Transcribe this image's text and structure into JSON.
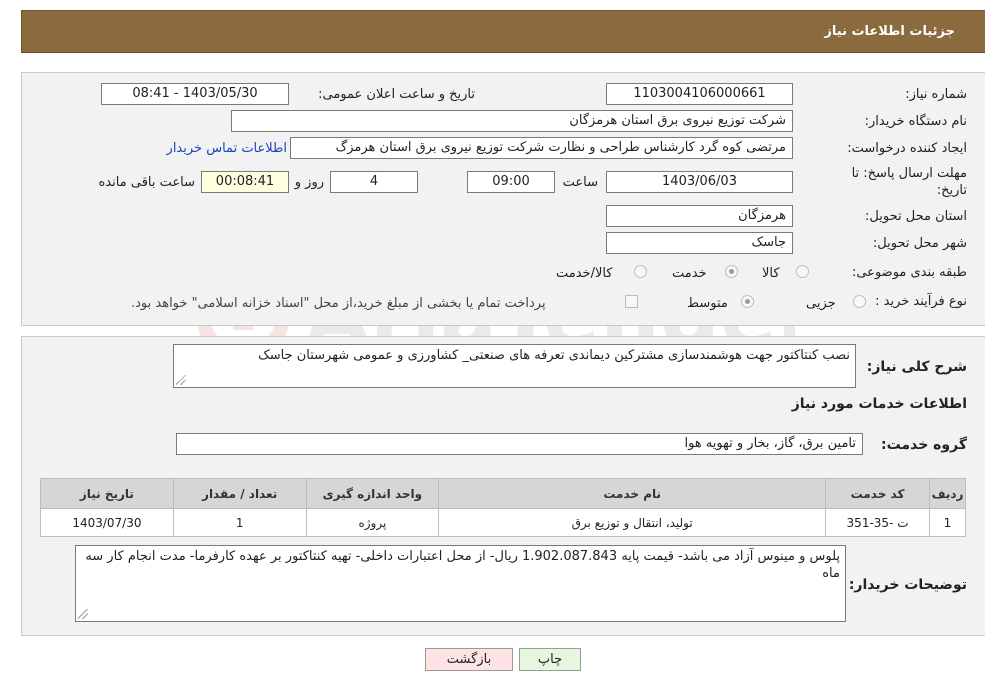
{
  "header": {
    "title": "جزئیات اطلاعات نیاز"
  },
  "fields": {
    "need_number_label": "شماره نیاز:",
    "need_number": "1103004106000661",
    "announce_label": "تاریخ و ساعت اعلان عمومی:",
    "announce_value": "1403/05/30 - 08:41",
    "buyer_org_label": "نام دستگاه خریدار:",
    "buyer_org": "شرکت توزیع نیروی برق استان هرمزگان",
    "requester_label": "ایجاد کننده درخواست:",
    "requester": "مرتضی کوه گرد کارشناس طراحی و نظارت شرکت توزیع نیروی برق استان هرمزگ",
    "contact_link": "اطلاعات تماس خریدار",
    "deadline_label_1": "مهلت ارسال پاسخ: تا",
    "deadline_label_2": "تاریخ:",
    "deadline_date": "1403/06/03",
    "time_label": "ساعت",
    "deadline_time": "09:00",
    "days_value": "4",
    "days_label": "روز و",
    "remaining_time": "00:08:41",
    "remaining_label": "ساعت باقی مانده",
    "province_label": "استان محل تحویل:",
    "province": "هرمزگان",
    "city_label": "شهر محل تحویل:",
    "city": "جاسک",
    "category_label": "طبقه بندی موضوعی:",
    "category_options": [
      "کالا",
      "خدمت",
      "کالا/خدمت"
    ],
    "category_selected": "خدمت",
    "process_label": "نوع فرآیند خرید :",
    "process_options": [
      "جزیی",
      "متوسط"
    ],
    "process_selected": "متوسط",
    "payment_note": "پرداخت تمام یا بخشی از مبلغ خرید،از محل \"اسناد خزانه اسلامی\" خواهد بود."
  },
  "description": {
    "label": "شرح کلی نیاز:",
    "text": "نصب کنتاکتور جهت هوشمندسازی مشترکین دیماندی تعرفه های صنعتی_ کشاورزی و عمومی شهرستان جاسک"
  },
  "services": {
    "title": "اطلاعات خدمات مورد نیاز",
    "group_label": "گروه خدمت:",
    "group_value": "تامین برق، گاز، بخار و تهویه هوا",
    "columns": [
      "ردیف",
      "کد خدمت",
      "نام خدمت",
      "واحد اندازه گیری",
      "تعداد / مقدار",
      "تاریخ نیاز"
    ],
    "rows": [
      [
        "1",
        "ت -35-351",
        "تولید، انتقال و توزیع برق",
        "پروژه",
        "1",
        "1403/07/30"
      ]
    ]
  },
  "buyer_notes": {
    "label": "توضیحات خریدار:",
    "text": "پلوس و مینوس آزاد می باشد- قیمت پایه   1.902.087.843 ریال- از محل اعتبارات داخلی- تهیه کنتاکتور بر عهده کارفرما- مدت انجام کار سه ماه"
  },
  "buttons": {
    "print": "چاپ",
    "back": "بازگشت"
  },
  "watermark_text": "AriaTender.neT",
  "colors": {
    "header_bg": "#8b6a3e",
    "panel_bg": "#f2f2f2",
    "back_button_bg": "#fde3e3",
    "print_button_bg": "#e6f7e0",
    "link": "#1a44c8",
    "remaining_bg": "#ffffe0"
  }
}
